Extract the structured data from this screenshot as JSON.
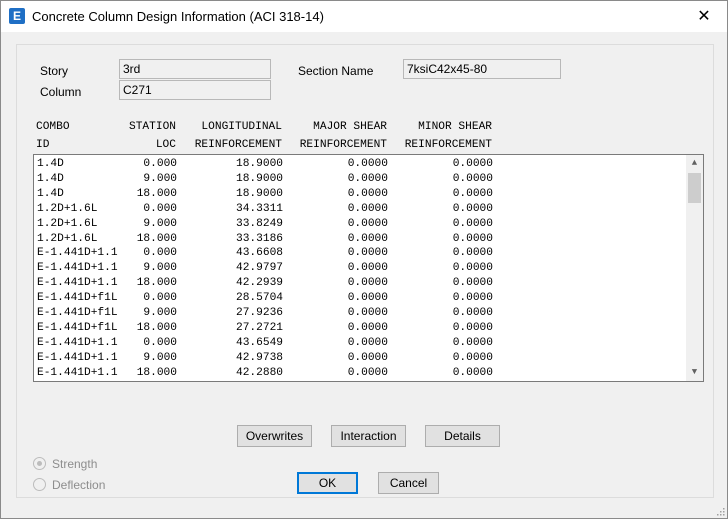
{
  "window": {
    "title": "Concrete Column Design Information (ACI 318-14)",
    "icon_letter": "E",
    "close_glyph": "✕"
  },
  "info": {
    "story_label": "Story",
    "story_value": "3rd",
    "column_label": "Column",
    "column_value": "C271",
    "section_label": "Section Name",
    "section_value": "7ksiC42x45-80"
  },
  "table": {
    "headers": [
      [
        "COMBO",
        "STATION",
        "LONGITUDINAL",
        "MAJOR SHEAR",
        "MINOR SHEAR"
      ],
      [
        "ID",
        "LOC",
        "REINFORCEMENT",
        "REINFORCEMENT",
        "REINFORCEMENT"
      ]
    ],
    "rows": [
      [
        "1.4D",
        "0.000",
        "18.9000",
        "0.0000",
        "0.0000"
      ],
      [
        "1.4D",
        "9.000",
        "18.9000",
        "0.0000",
        "0.0000"
      ],
      [
        "1.4D",
        "18.000",
        "18.9000",
        "0.0000",
        "0.0000"
      ],
      [
        "1.2D+1.6L",
        "0.000",
        "34.3311",
        "0.0000",
        "0.0000"
      ],
      [
        "1.2D+1.6L",
        "9.000",
        "33.8249",
        "0.0000",
        "0.0000"
      ],
      [
        "1.2D+1.6L",
        "18.000",
        "33.3186",
        "0.0000",
        "0.0000"
      ],
      [
        "E-1.441D+1.1",
        "0.000",
        "43.6608",
        "0.0000",
        "0.0000"
      ],
      [
        "E-1.441D+1.1",
        "9.000",
        "42.9797",
        "0.0000",
        "0.0000"
      ],
      [
        "E-1.441D+1.1",
        "18.000",
        "42.2939",
        "0.0000",
        "0.0000"
      ],
      [
        "E-1.441D+f1L",
        "0.000",
        "28.5704",
        "0.0000",
        "0.0000"
      ],
      [
        "E-1.441D+f1L",
        "9.000",
        "27.9236",
        "0.0000",
        "0.0000"
      ],
      [
        "E-1.441D+f1L",
        "18.000",
        "27.2721",
        "0.0000",
        "0.0000"
      ],
      [
        "E-1.441D+1.1",
        "0.000",
        "43.6549",
        "0.0000",
        "0.0000"
      ],
      [
        "E-1.441D+1.1",
        "9.000",
        "42.9738",
        "0.0000",
        "0.0000"
      ],
      [
        "E-1.441D+1.1",
        "18.000",
        "42.2880",
        "0.0000",
        "0.0000"
      ]
    ],
    "scroll_up_glyph": "▲",
    "scroll_down_glyph": "▼"
  },
  "buttons": {
    "overwrites": "Overwrites",
    "interaction": "Interaction",
    "details": "Details",
    "ok": "OK",
    "cancel": "Cancel"
  },
  "options": {
    "strength": "Strength",
    "deflection": "Deflection",
    "selected": "Strength"
  },
  "icons": {
    "app": "etabs-app-icon",
    "close": "close-icon",
    "scroll_up": "chevron-up-icon",
    "scroll_down": "chevron-down-icon"
  }
}
